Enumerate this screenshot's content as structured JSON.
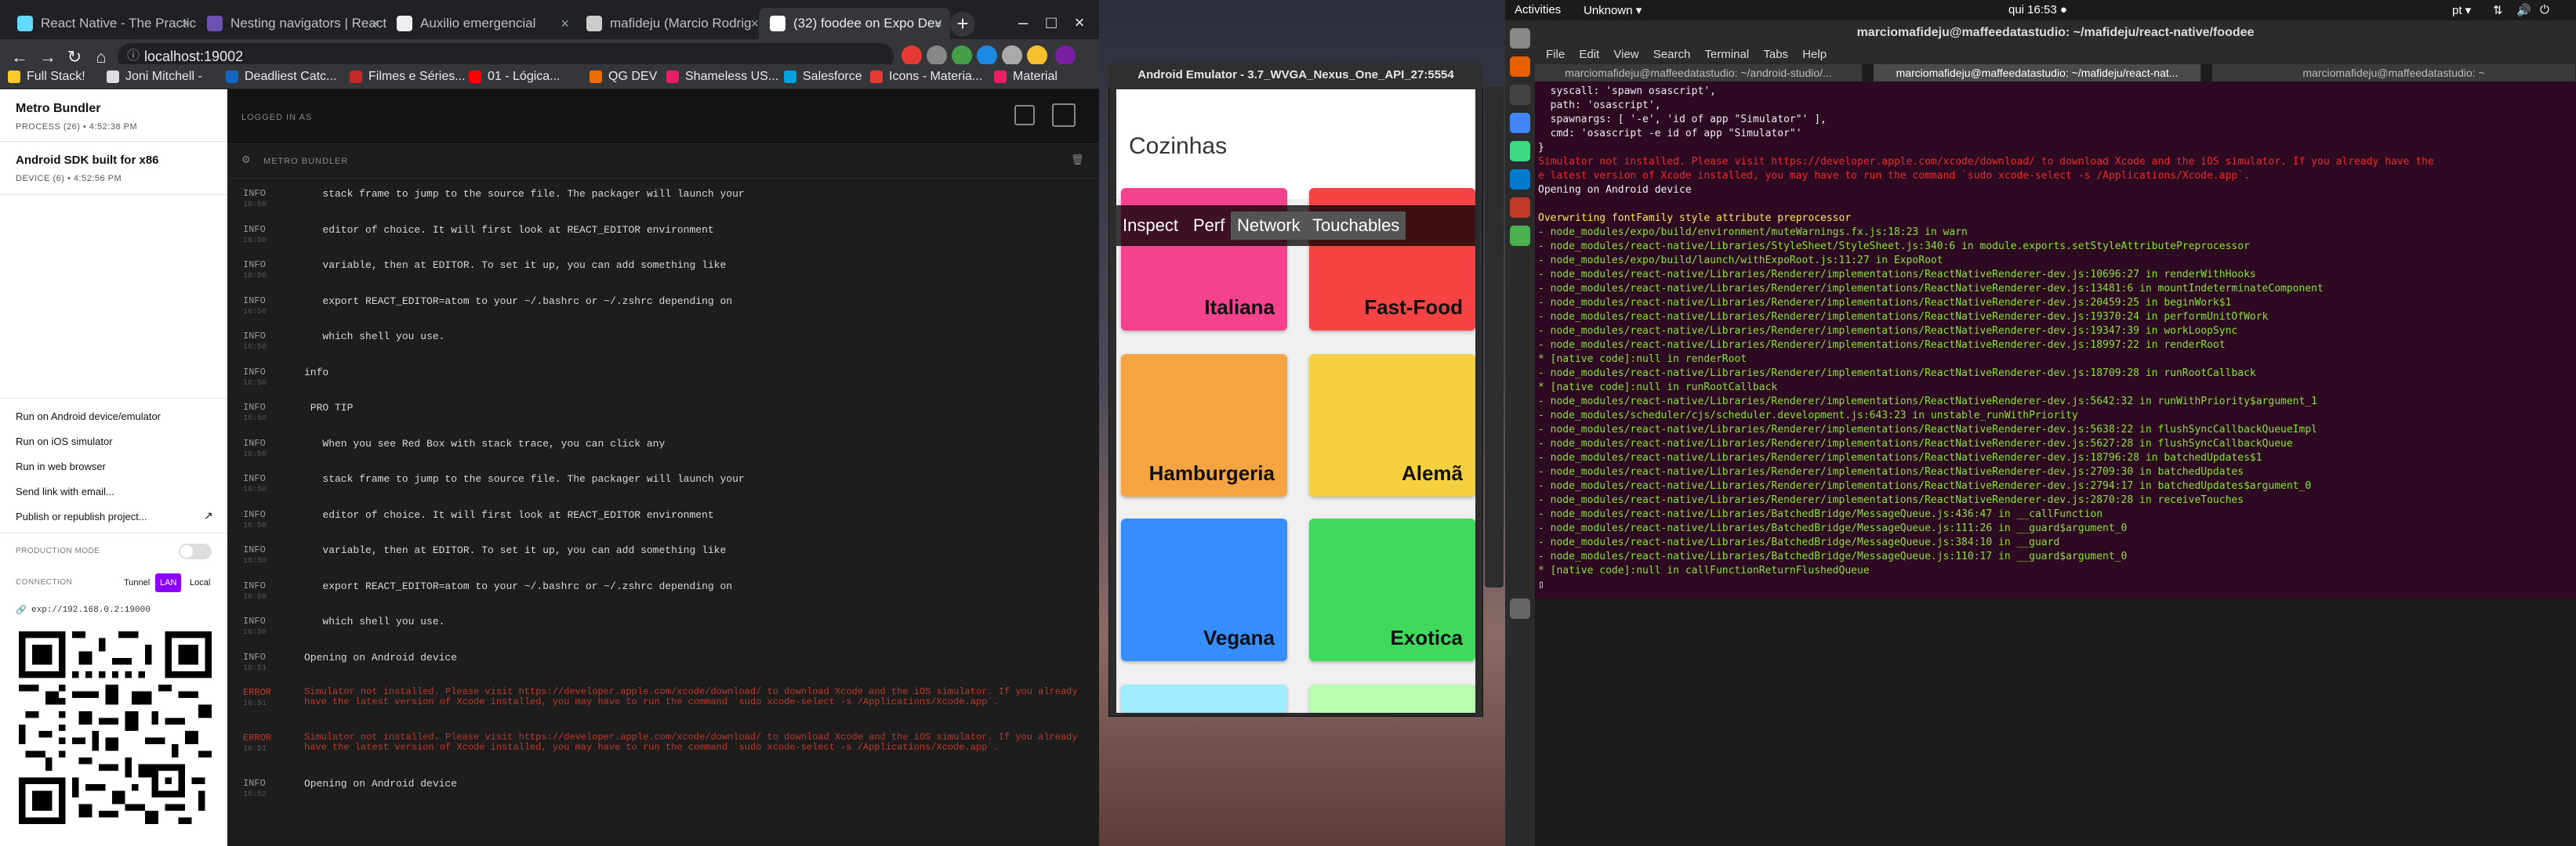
{
  "chrome": {
    "tabs": [
      {
        "label": "React Native - The Practic",
        "color": "#61dafb"
      },
      {
        "label": "Nesting navigators | React",
        "color": "#6b52ae"
      },
      {
        "label": "Auxilio emergencial",
        "color": "#eeeeee"
      },
      {
        "label": "mafideju (Marcio Rodrig",
        "color": "#cccccc"
      },
      {
        "label": "(32) foodee on Expo Dev",
        "color": "#ffffff"
      }
    ],
    "new_tab": "+",
    "url": "localhost:19002",
    "bookmarks": [
      "Full Stack!",
      "Joni Mitchell -",
      "Deadliest Catc...",
      "Filmes e Séries...",
      "01 - Lógica...",
      "QG DEV",
      "Shameless US...",
      "Salesforce",
      "Icons - Materia...",
      "Material"
    ]
  },
  "expo": {
    "device1": {
      "title": "Metro Bundler",
      "sub": "PROCESS (26) • 4:52:38 PM"
    },
    "device2": {
      "title": "Android SDK built for x86",
      "sub": "DEVICE (6) • 4:52:56 PM"
    },
    "actions": [
      "Run on Android device/emulator",
      "Run on iOS simulator",
      "Run in web browser",
      "Send link with email...",
      "Publish or republish project..."
    ],
    "production_mode": "PRODUCTION MODE",
    "connection": "CONNECTION",
    "conn_options": [
      "Tunnel",
      "LAN",
      "Local"
    ],
    "exp_url": "exp://192.168.0.2:19000",
    "logged_in": "LOGGED IN AS",
    "bundler_title": "METRO BUNDLER",
    "logs": [
      {
        "level": "INFO",
        "time": "16:50",
        "msg": "   stack frame to jump to the source file. The packager will launch your"
      },
      {
        "level": "INFO",
        "time": "16:50",
        "msg": "   editor of choice. It will first look at REACT_EDITOR environment"
      },
      {
        "level": "INFO",
        "time": "16:50",
        "msg": "   variable, then at EDITOR. To set it up, you can add something like"
      },
      {
        "level": "INFO",
        "time": "16:50",
        "msg": "   export REACT_EDITOR=atom to your ~/.bashrc or ~/.zshrc depending on"
      },
      {
        "level": "INFO",
        "time": "16:50",
        "msg": "   which shell you use."
      },
      {
        "level": "INFO",
        "time": "16:50",
        "msg": "info"
      },
      {
        "level": "INFO",
        "time": "16:50",
        "msg": " PRO TIP"
      },
      {
        "level": "INFO",
        "time": "16:50",
        "msg": "   When you see Red Box with stack trace, you can click any"
      },
      {
        "level": "INFO",
        "time": "16:50",
        "msg": "   stack frame to jump to the source file. The packager will launch your"
      },
      {
        "level": "INFO",
        "time": "16:50",
        "msg": "   editor of choice. It will first look at REACT_EDITOR environment"
      },
      {
        "level": "INFO",
        "time": "16:50",
        "msg": "   variable, then at EDITOR. To set it up, you can add something like"
      },
      {
        "level": "INFO",
        "time": "16:50",
        "msg": "   export REACT_EDITOR=atom to your ~/.bashrc or ~/.zshrc depending on"
      },
      {
        "level": "INFO",
        "time": "16:50",
        "msg": "   which shell you use."
      },
      {
        "level": "INFO",
        "time": "16:51",
        "msg": "Opening on Android device"
      },
      {
        "level": "ERROR",
        "time": "16:51",
        "msg": "Simulator not installed. Please visit https://developer.apple.com/xcode/download/ to download Xcode and the iOS simulator. If you already have the latest version of Xcode installed, you may have to run the command `sudo xcode-select -s /Applications/Xcode.app`."
      },
      {
        "level": "ERROR",
        "time": "16:51",
        "msg": "Simulator not installed. Please visit https://developer.apple.com/xcode/download/ to download Xcode and the iOS simulator. If you already have the latest version of Xcode installed, you may have to run the command `sudo xcode-select -s /Applications/Xcode.app`."
      },
      {
        "level": "INFO",
        "time": "16:52",
        "msg": "Opening on Android device"
      }
    ]
  },
  "emulator": {
    "title": "Android Emulator - 3.7_WVGA_Nexus_One_API_27:5554",
    "app_title": "Cozinhas",
    "perf": [
      "Inspect",
      "Perf",
      "Network",
      "Touchables"
    ],
    "tiles": [
      {
        "label": "Italiana",
        "color": "#f5428d"
      },
      {
        "label": "Fast-Food",
        "color": "#f54242"
      },
      {
        "label": "Hamburgeria",
        "color": "#f5a442"
      },
      {
        "label": "Alemã",
        "color": "#f5d142"
      },
      {
        "label": "Vegana",
        "color": "#368dff"
      },
      {
        "label": "Exotica",
        "color": "#41d95d"
      },
      {
        "label": "",
        "color": "#9eecff"
      },
      {
        "label": "",
        "color": "#b9ffb0"
      }
    ]
  },
  "ubuntu": {
    "activities": "Activities",
    "unknown": "Unknown ▾",
    "clock": "qui 16:53 ●",
    "lang": "pt ▾"
  },
  "terminal": {
    "title": "marciomafideju@maffeedatastudio: ~/mafideju/react-native/foodee",
    "menu": [
      "File",
      "Edit",
      "View",
      "Search",
      "Terminal",
      "Tabs",
      "Help"
    ],
    "tabs": [
      "marciomafideju@maffeedatastudio: ~/android-studio/...",
      "marciomafideju@maffeedatastudio: ~/mafideju/react-nat...",
      "marciomafideju@maffeedatastudio: ~"
    ],
    "lines": [
      {
        "t": "  syscall: 'spawn osascript',",
        "c": "w"
      },
      {
        "t": "  path: 'osascript',",
        "c": "w"
      },
      {
        "t": "  spawnargs: [ '-e', 'id of app \"Simulator\"' ],",
        "c": "w"
      },
      {
        "t": "  cmd: 'osascript -e id of app \"Simulator\"'",
        "c": "w"
      },
      {
        "t": "}",
        "c": "w"
      },
      {
        "t": "Simulator not installed. Please visit https://developer.apple.com/xcode/download/ to download Xcode and the iOS simulator. If you already have the",
        "c": "r"
      },
      {
        "t": "e latest version of Xcode installed, you may have to run the command `sudo xcode-select -s /Applications/Xcode.app`.",
        "c": "r"
      },
      {
        "t": "Opening on Android device",
        "c": "w"
      },
      {
        "t": "",
        "c": "w"
      },
      {
        "t": "Overwriting fontFamily style attribute preprocessor",
        "c": "y"
      },
      {
        "t": "- node_modules/expo/build/environment/muteWarnings.fx.js:18:23 in warn",
        "c": "g"
      },
      {
        "t": "- node_modules/react-native/Libraries/StyleSheet/StyleSheet.js:340:6 in module.exports.setStyleAttributePreprocessor",
        "c": "g"
      },
      {
        "t": "- node_modules/expo/build/launch/withExpoRoot.js:11:27 in ExpoRoot",
        "c": "g"
      },
      {
        "t": "- node_modules/react-native/Libraries/Renderer/implementations/ReactNativeRenderer-dev.js:10696:27 in renderWithHooks",
        "c": "g"
      },
      {
        "t": "- node_modules/react-native/Libraries/Renderer/implementations/ReactNativeRenderer-dev.js:13481:6 in mountIndeterminateComponent",
        "c": "g"
      },
      {
        "t": "- node_modules/react-native/Libraries/Renderer/implementations/ReactNativeRenderer-dev.js:20459:25 in beginWork$1",
        "c": "g"
      },
      {
        "t": "- node_modules/react-native/Libraries/Renderer/implementations/ReactNativeRenderer-dev.js:19370:24 in performUnitOfWork",
        "c": "g"
      },
      {
        "t": "- node_modules/react-native/Libraries/Renderer/implementations/ReactNativeRenderer-dev.js:19347:39 in workLoopSync",
        "c": "g"
      },
      {
        "t": "- node_modules/react-native/Libraries/Renderer/implementations/ReactNativeRenderer-dev.js:18997:22 in renderRoot",
        "c": "g"
      },
      {
        "t": "* [native code]:null in renderRoot",
        "c": "g"
      },
      {
        "t": "- node_modules/react-native/Libraries/Renderer/implementations/ReactNativeRenderer-dev.js:18709:28 in runRootCallback",
        "c": "g"
      },
      {
        "t": "* [native code]:null in runRootCallback",
        "c": "g"
      },
      {
        "t": "- node_modules/react-native/Libraries/Renderer/implementations/ReactNativeRenderer-dev.js:5642:32 in runWithPriority$argument_1",
        "c": "g"
      },
      {
        "t": "- node_modules/scheduler/cjs/scheduler.development.js:643:23 in unstable_runWithPriority",
        "c": "g"
      },
      {
        "t": "- node_modules/react-native/Libraries/Renderer/implementations/ReactNativeRenderer-dev.js:5638:22 in flushSyncCallbackQueueImpl",
        "c": "g"
      },
      {
        "t": "- node_modules/react-native/Libraries/Renderer/implementations/ReactNativeRenderer-dev.js:5627:28 in flushSyncCallbackQueue",
        "c": "g"
      },
      {
        "t": "- node_modules/react-native/Libraries/Renderer/implementations/ReactNativeRenderer-dev.js:18796:28 in batchedUpdates$1",
        "c": "g"
      },
      {
        "t": "- node_modules/react-native/Libraries/Renderer/implementations/ReactNativeRenderer-dev.js:2709:30 in batchedUpdates",
        "c": "g"
      },
      {
        "t": "- node_modules/react-native/Libraries/Renderer/implementations/ReactNativeRenderer-dev.js:2794:17 in batchedUpdates$argument_0",
        "c": "g"
      },
      {
        "t": "- node_modules/react-native/Libraries/Renderer/implementations/ReactNativeRenderer-dev.js:2870:28 in receiveTouches",
        "c": "g"
      },
      {
        "t": "- node_modules/react-native/Libraries/BatchedBridge/MessageQueue.js:436:47 in __callFunction",
        "c": "g"
      },
      {
        "t": "- node_modules/react-native/Libraries/BatchedBridge/MessageQueue.js:111:26 in __guard$argument_0",
        "c": "g"
      },
      {
        "t": "- node_modules/react-native/Libraries/BatchedBridge/MessageQueue.js:384:10 in __guard",
        "c": "g"
      },
      {
        "t": "- node_modules/react-native/Libraries/BatchedBridge/MessageQueue.js:110:17 in __guard$argument_0",
        "c": "g"
      },
      {
        "t": "* [native code]:null in callFunctionReturnFlushedQueue",
        "c": "g"
      },
      {
        "t": "▯",
        "c": "w"
      }
    ]
  }
}
